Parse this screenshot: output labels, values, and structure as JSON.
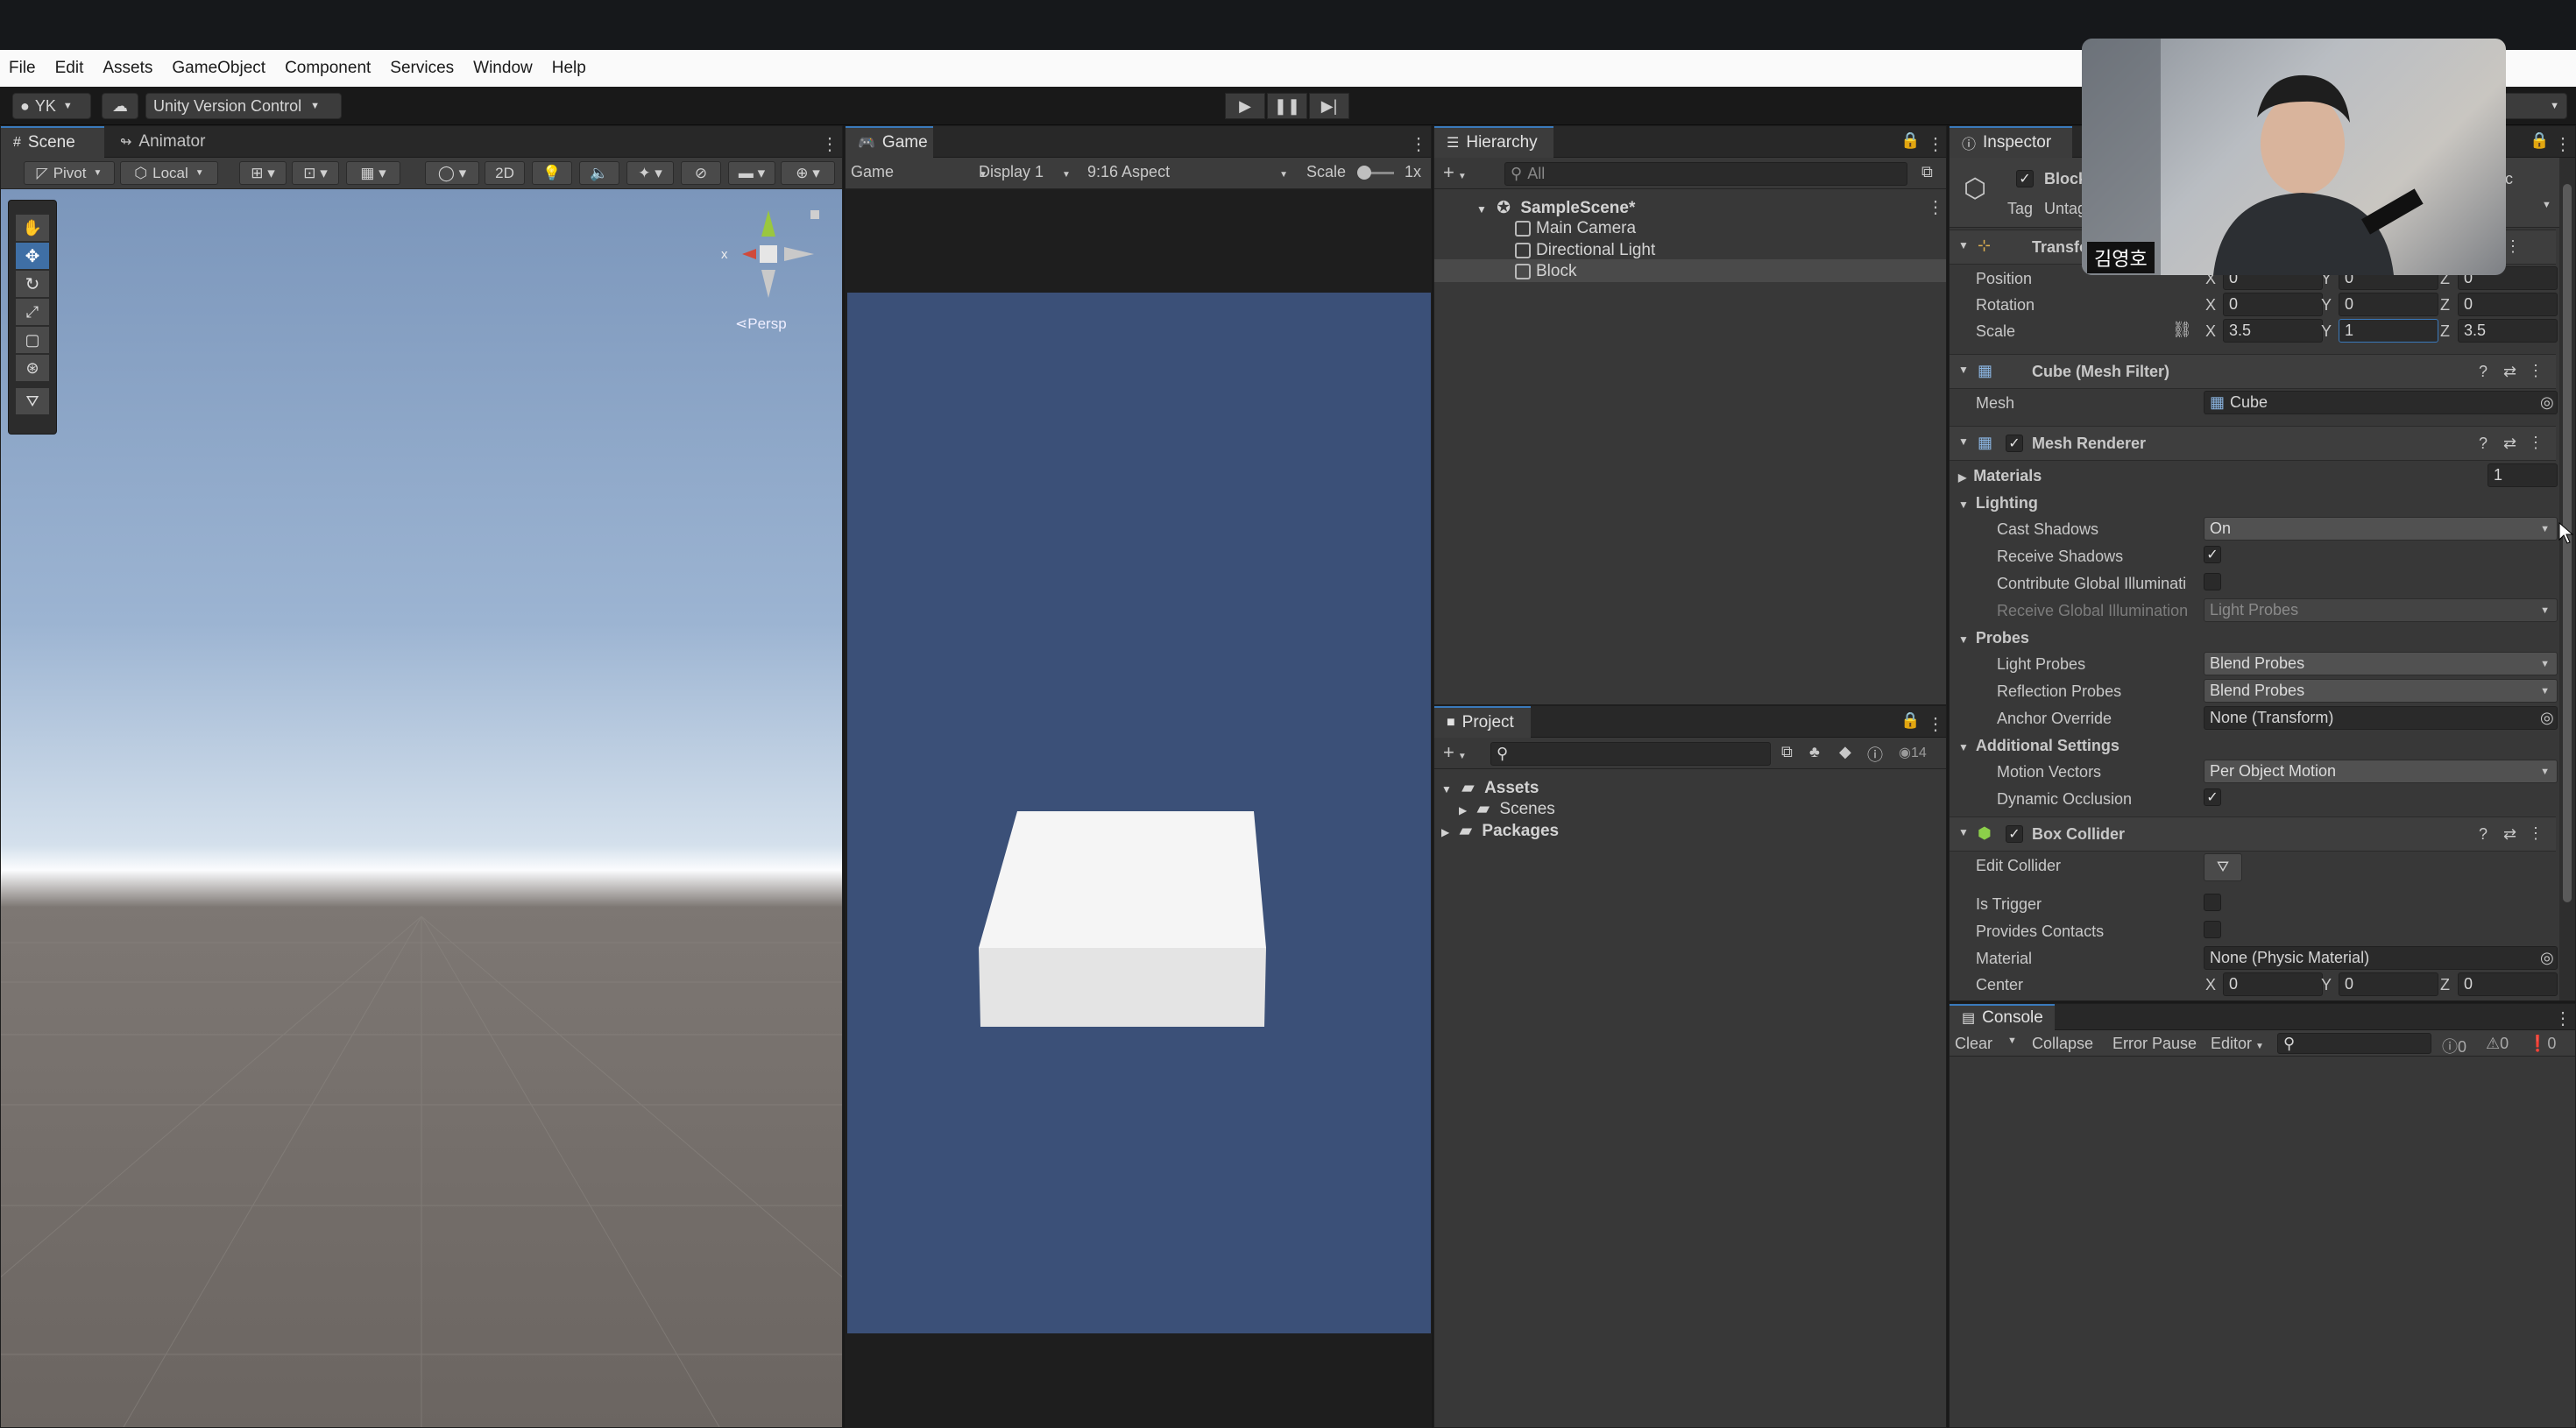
{
  "menu": [
    "File",
    "Edit",
    "Assets",
    "GameObject",
    "Component",
    "Services",
    "Window",
    "Help"
  ],
  "toolbar": {
    "account": "YK",
    "version_control": "Unity Version Control"
  },
  "scene": {
    "tabs": [
      "Scene",
      "Animator"
    ],
    "pivot": "Pivot",
    "local": "Local",
    "mode_2d": "2D",
    "persp": "Persp",
    "gizmo_x": "x"
  },
  "game": {
    "tab": "Game",
    "view": "Game",
    "display": "Display 1",
    "aspect": "9:16 Aspect",
    "scale_label": "Scale",
    "scale_value": "1x"
  },
  "hierarchy": {
    "tab": "Hierarchy",
    "search_placeholder": "All",
    "scene": "SampleScene*",
    "items": [
      "Main Camera",
      "Directional Light",
      "Block"
    ]
  },
  "project": {
    "tab": "Project",
    "hidden_count": "14",
    "assets": "Assets",
    "scenes": "Scenes",
    "packages": "Packages"
  },
  "inspector": {
    "tab": "Inspector",
    "object_name": "Block",
    "tag_label": "Tag",
    "tag_value": "Untagged",
    "layer_hint": "c",
    "transform": {
      "title": "Transform",
      "position_label": "Position",
      "position": {
        "x": "0",
        "y": "0",
        "z": "0"
      },
      "rotation_label": "Rotation",
      "rotation": {
        "x": "0",
        "y": "0",
        "z": "0"
      },
      "scale_label": "Scale",
      "scale": {
        "x": "3.5",
        "y": "1",
        "z": "3.5"
      }
    },
    "mesh_filter": {
      "title": "Cube (Mesh Filter)",
      "mesh_label": "Mesh",
      "mesh_value": "Cube"
    },
    "mesh_renderer": {
      "title": "Mesh Renderer",
      "materials_label": "Materials",
      "materials_count": "1",
      "lighting_label": "Lighting",
      "cast_shadows_label": "Cast Shadows",
      "cast_shadows_value": "On",
      "receive_shadows_label": "Receive Shadows",
      "contribute_gi_label": "Contribute Global Illuminati",
      "receive_gi_label": "Receive Global Illumination",
      "receive_gi_value": "Light Probes",
      "probes_label": "Probes",
      "light_probes_label": "Light Probes",
      "light_probes_value": "Blend Probes",
      "reflection_probes_label": "Reflection Probes",
      "reflection_probes_value": "Blend Probes",
      "anchor_override_label": "Anchor Override",
      "anchor_override_value": "None (Transform)",
      "additional_label": "Additional Settings",
      "motion_vectors_label": "Motion Vectors",
      "motion_vectors_value": "Per Object Motion",
      "dynamic_occlusion_label": "Dynamic Occlusion"
    },
    "box_collider": {
      "title": "Box Collider",
      "edit_collider_label": "Edit Collider",
      "is_trigger_label": "Is Trigger",
      "provides_contacts_label": "Provides Contacts",
      "material_label": "Material",
      "material_value": "None (Physic Material)",
      "center_label": "Center",
      "center": {
        "x": "0",
        "y": "0",
        "z": "0"
      }
    }
  },
  "console": {
    "tab": "Console",
    "clear": "Clear",
    "collapse": "Collapse",
    "error_pause": "Error Pause",
    "editor": "Editor",
    "log_count": "0",
    "warn_count": "0",
    "error_count": "0"
  },
  "webcam": {
    "name": "김영호"
  },
  "axis": {
    "x": "X",
    "y": "Y",
    "z": "Z"
  },
  "colors": {
    "accent": "#3a79bb",
    "game_bg": "#3b5078",
    "panel": "#383838"
  }
}
